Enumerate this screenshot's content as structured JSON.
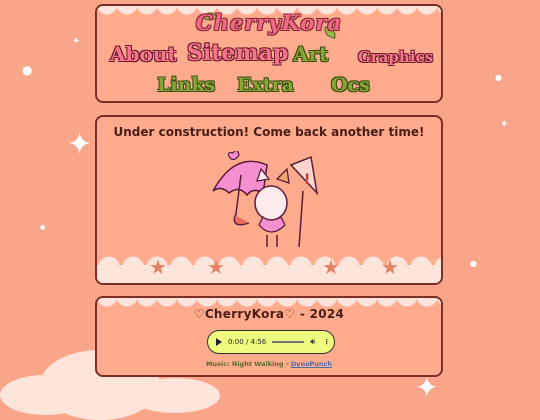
{
  "header": {
    "logo_text": "CherryKora",
    "nav": [
      {
        "label": "About",
        "color": "pink"
      },
      {
        "label": "Sitemap",
        "color": "pink"
      },
      {
        "label": "Art",
        "color": "green"
      },
      {
        "label": "Graphics",
        "color": "pink"
      },
      {
        "label": "Links",
        "color": "green"
      },
      {
        "label": "Extra",
        "color": "green"
      },
      {
        "label": "Ocs",
        "color": "green"
      }
    ]
  },
  "main": {
    "message": "Under construction! Come back another time!"
  },
  "footer": {
    "title": "♡CherryKora♡ - 2024",
    "player": {
      "time": "0:00 / 4:56",
      "progress": 0
    },
    "credits": {
      "prefix": "Music:",
      "song": "Night Walking",
      "separator": "-",
      "artist": "DynoPunch"
    }
  },
  "colors": {
    "background": "#f9a58a",
    "panel_border": "#7a2e25",
    "pink_text": "#f8738c",
    "green_text": "#86a737",
    "player_bg": "#eefb7e"
  }
}
